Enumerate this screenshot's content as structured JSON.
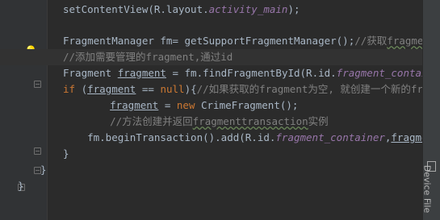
{
  "editor": {
    "lines": [
      {
        "segments": [
          {
            "t": "setContentView(R.layout."
          },
          {
            "t": "activity_main",
            "c": "fld"
          },
          {
            "t": ");"
          }
        ]
      },
      {
        "segments": []
      },
      {
        "segments": [
          {
            "t": "FragmentManager fm= getSupportFragmentManager();"
          },
          {
            "t": "//获取",
            "c": "cm"
          },
          {
            "t": "fragmentma",
            "c": "cm wv"
          }
        ]
      },
      {
        "segments": [
          {
            "t": "//添加需要管理的fragment,通过id",
            "c": "cm"
          }
        ]
      },
      {
        "segments": [
          {
            "t": "Fragment "
          },
          {
            "t": "fragment",
            "c": "u"
          },
          {
            "t": " = fm.findFragmentById(R.id."
          },
          {
            "t": "fragment_container",
            "c": "fld"
          }
        ]
      },
      {
        "segments": [
          {
            "t": "if",
            "c": "kw"
          },
          {
            "t": " ("
          },
          {
            "t": "fragment",
            "c": "u"
          },
          {
            "t": " == "
          },
          {
            "t": "null",
            "c": "kw"
          },
          {
            "t": "){"
          },
          {
            "t": "//如果获取的fragment为空, 就创建一个新的frag",
            "c": "cm"
          }
        ]
      },
      {
        "segments": [
          {
            "t": "    "
          },
          {
            "t": "fragment",
            "c": "u"
          },
          {
            "t": " = "
          },
          {
            "t": "new",
            "c": "kw"
          },
          {
            "t": " CrimeFragment();"
          }
        ]
      },
      {
        "segments": [
          {
            "t": "    "
          },
          {
            "t": "//方法创建并返回",
            "c": "cm"
          },
          {
            "t": "fragmenttransaction",
            "c": "cm wv"
          },
          {
            "t": "实例",
            "c": "cm"
          }
        ]
      },
      {
        "segments": [
          {
            "t": "    fm.beginTransaction().add(R.id."
          },
          {
            "t": "fragment_container",
            "c": "fld"
          },
          {
            "t": ","
          },
          {
            "t": "fragment",
            "c": "u"
          },
          {
            "t": ")"
          }
        ]
      },
      {
        "segments": [
          {
            "t": "}"
          }
        ]
      },
      {
        "segments": [
          {
            "t": "}"
          }
        ]
      },
      {
        "segments": [
          {
            "t": "}"
          }
        ]
      }
    ]
  },
  "right_panel": {
    "label": "Device File"
  },
  "icons": {
    "intention": "lightbulb-icon"
  }
}
